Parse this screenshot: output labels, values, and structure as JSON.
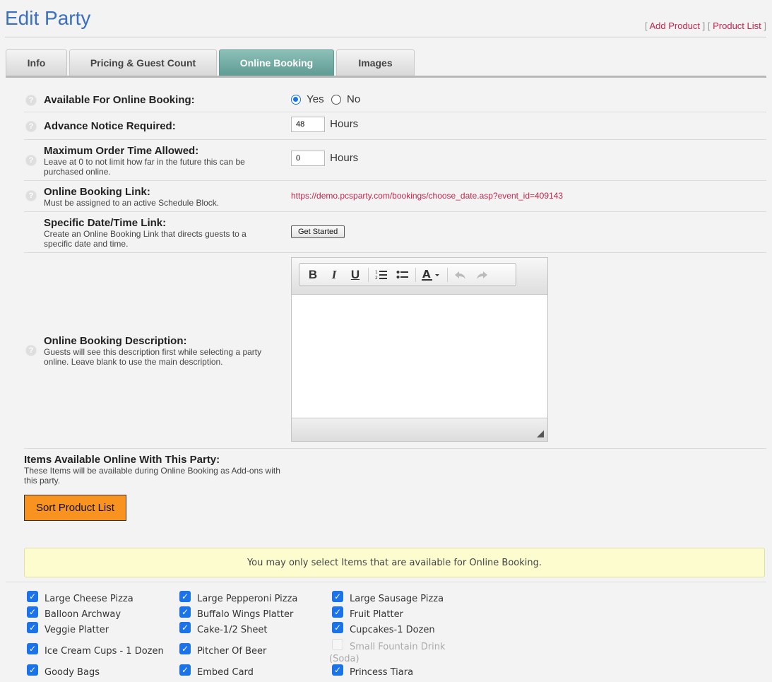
{
  "header": {
    "title": "Edit Party",
    "links": [
      {
        "label": "Add Product"
      },
      {
        "label": "Product List"
      }
    ]
  },
  "tabs": [
    {
      "label": "Info",
      "active": false
    },
    {
      "label": "Pricing & Guest Count",
      "active": false
    },
    {
      "label": "Online Booking",
      "active": true
    },
    {
      "label": "Images",
      "active": false
    }
  ],
  "form": {
    "available": {
      "label": "Available For Online Booking:",
      "yes_label": "Yes",
      "no_label": "No",
      "selected": "Yes"
    },
    "advance_notice": {
      "label": "Advance Notice Required:",
      "value": "48",
      "unit": "Hours"
    },
    "max_order_time": {
      "label": "Maximum Order Time Allowed:",
      "description": "Leave at 0 to not limit how far in the future this can be purchased online.",
      "value": "0",
      "unit": "Hours"
    },
    "booking_link": {
      "label": "Online Booking Link:",
      "description": "Must be assigned to an active Schedule Block.",
      "value": "https://demo.pcsparty.com/bookings/choose_date.asp?event_id=409143"
    },
    "specific_link": {
      "label": "Specific Date/Time Link:",
      "description": "Create an Online Booking Link that directs guests to a specific date and time.",
      "button": "Get Started"
    },
    "booking_description": {
      "label": "Online Booking Description:",
      "description": "Guests will see this description first while selecting a party online. Leave blank to use the main description.",
      "toolbar": [
        "bold-icon",
        "italic-icon",
        "underline-icon",
        "ordered-list-icon",
        "unordered-list-icon",
        "text-color-icon",
        "undo-icon",
        "redo-icon"
      ]
    },
    "items_section": {
      "label": "Items Available Online With This Party:",
      "description": "These Items will be available during Online Booking as Add-ons with this party.",
      "sort_button": "Sort Product List",
      "notice": "You may only select Items that are available for Online Booking."
    }
  },
  "items": [
    {
      "name": "Large Cheese Pizza",
      "checked": true,
      "disabled": false
    },
    {
      "name": "Large Pepperoni Pizza",
      "checked": true,
      "disabled": false
    },
    {
      "name": "Large Sausage Pizza",
      "checked": true,
      "disabled": false
    },
    {
      "name": "Balloon Archway",
      "checked": true,
      "disabled": false
    },
    {
      "name": "Buffalo Wings Platter",
      "checked": true,
      "disabled": false
    },
    {
      "name": "Fruit Platter",
      "checked": true,
      "disabled": false
    },
    {
      "name": "Veggie Platter",
      "checked": true,
      "disabled": false
    },
    {
      "name": "Cake-1/2 Sheet",
      "checked": true,
      "disabled": false
    },
    {
      "name": "Cupcakes-1 Dozen",
      "checked": true,
      "disabled": false
    },
    {
      "name": "Ice Cream Cups - 1 Dozen",
      "checked": true,
      "disabled": false
    },
    {
      "name": "Pitcher Of Beer",
      "checked": true,
      "disabled": false
    },
    {
      "name": "Small Fountain Drink",
      "name2": "(Soda)",
      "checked": false,
      "disabled": true
    },
    {
      "name": "Goody Bags",
      "checked": true,
      "disabled": false
    },
    {
      "name": "Embed Card",
      "checked": true,
      "disabled": false
    },
    {
      "name": "Princess Tiara",
      "checked": true,
      "disabled": false
    }
  ],
  "colors": {
    "title": "#3a6fc4",
    "active_tab": "#6fa8a0",
    "link": "#c7254e",
    "sort_button": "#f7931e",
    "notice_bg": "#fcfccf",
    "checkbox": "#1a73e8"
  }
}
